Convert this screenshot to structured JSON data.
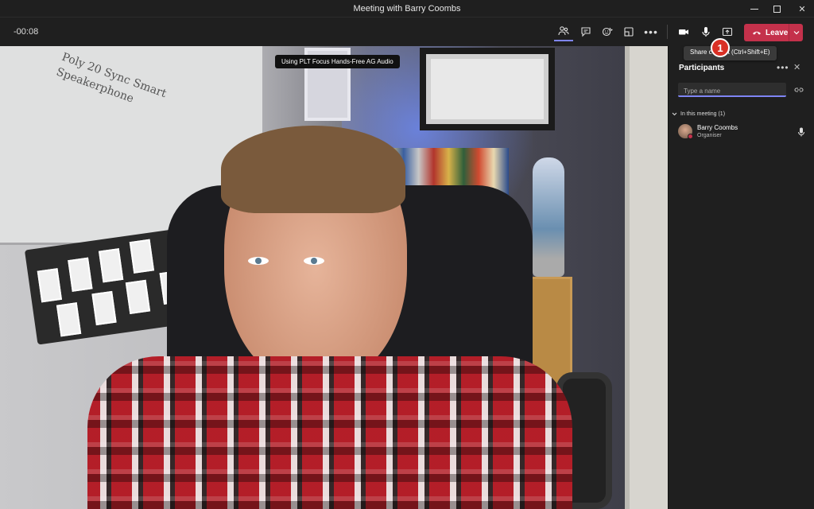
{
  "window": {
    "title": "Meeting with Barry Coombs"
  },
  "toolbar": {
    "timer": "-00:08",
    "leave_label": "Leave",
    "accent_color": "#7f85f5",
    "leave_color": "#c4314b",
    "icons": [
      "people-icon",
      "chat-icon",
      "reactions-icon",
      "rooms-icon",
      "more-icon",
      "camera-icon",
      "microphone-icon",
      "share-icon",
      "hang-up-icon",
      "chevron-down-icon"
    ]
  },
  "tooltip": {
    "text": "Share content (Ctrl+Shift+E)"
  },
  "annotation": {
    "step_number": "1"
  },
  "video": {
    "device_label": "Using PLT Focus Hands-Free AG Audio",
    "whiteboard_text": "Poly 20 Sync Smart Speakerphone"
  },
  "participants": {
    "title": "Participants",
    "search_placeholder": "Type a name",
    "section_label": "In this meeting (1)",
    "members": [
      {
        "name": "Barry Coombs",
        "role": "Organiser",
        "presence": "busy"
      }
    ]
  }
}
